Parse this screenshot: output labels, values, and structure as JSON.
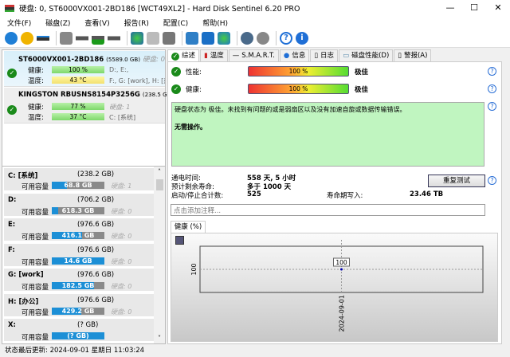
{
  "window": {
    "title": "硬盘:  0, ST6000VX001-2BD186 [WCT49XL2]  -  Hard Disk Sentinel 6.20 PRO",
    "minimize": "—",
    "maximize": "☐",
    "close": "✕"
  },
  "menu": [
    "文件(F)",
    "磁盘(Z)",
    "查看(V)",
    "报告(R)",
    "配置(C)",
    "帮助(H)"
  ],
  "toolbar": [
    "refresh-icon",
    "refresh-warning-icon",
    "disk-icon",
    "disk-gray-icon",
    "disk-clock-icon",
    "disk-check-icon",
    "disk-search-icon",
    "network-disk-icon",
    "usb-icon",
    "external-disk-icon",
    "notepad-icon",
    "mail-icon",
    "globe-monitor-icon",
    "gear-icon",
    "sound-icon",
    "help-icon",
    "info-icon"
  ],
  "disks": [
    {
      "name": "ST6000VX001-2BD186",
      "size": "(5589.0 GB)",
      "disk_no": "硬盘:  0",
      "health_label": "健康:",
      "health": "100 %",
      "health_pct": 100,
      "temp_label": "温度:",
      "temp": "43 °C",
      "parts1": "D:, E:,",
      "parts2": "F:, G: [work], H: [办公]"
    },
    {
      "name": "KINGSTON RBUSNS8154P3256G",
      "size": "(238.5 GB)",
      "disk_no": "硬盘:  1",
      "health_label": "健康:",
      "health": "77 %",
      "health_pct": 77,
      "temp_label": "温度:",
      "temp": "37 °C",
      "parts1": "",
      "parts2": "C: [系统]"
    }
  ],
  "volumes": [
    {
      "name": "C: [系统]",
      "size": "(238.2 GB)",
      "label": "可用容量",
      "free": "68.8 GB",
      "free_pct": 29,
      "disk": "硬盘:  1"
    },
    {
      "name": "D:",
      "size": "(706.2 GB)",
      "label": "可用容量",
      "free": "618.3 GB",
      "free_pct": 12,
      "disk": "硬盘:  0"
    },
    {
      "name": "E:",
      "size": "(976.6 GB)",
      "label": "可用容量",
      "free": "416.1 GB",
      "free_pct": 57,
      "disk": "硬盘:  0"
    },
    {
      "name": "F:",
      "size": "(976.6 GB)",
      "label": "可用容量",
      "free": "14.6 GB",
      "free_pct": 100,
      "disk": "硬盘:  0"
    },
    {
      "name": "G: [work]",
      "size": "(976.6 GB)",
      "label": "可用容量",
      "free": "182.5 GB",
      "free_pct": 81,
      "disk": "硬盘:  0"
    },
    {
      "name": "H: [办公]",
      "size": "(976.6 GB)",
      "label": "可用容量",
      "free": "429.2 GB",
      "free_pct": 56,
      "disk": "硬盘:  0"
    },
    {
      "name": "X:",
      "size": "(? GB)",
      "label": "可用容量",
      "free": "(? GB)",
      "free_pct": 100,
      "disk": ""
    }
  ],
  "status": "状态最后更新:   2024-09-01 星期日 11:03:24",
  "tabs": [
    "综述",
    "温度",
    "S.M.A.R.T.",
    "信息",
    "日志",
    "磁盘性能(D)",
    "警报(A)"
  ],
  "summary": {
    "perf_label": "性能:",
    "perf": "100 %",
    "perf_rating": "极佳",
    "health_label": "健康:",
    "health": "100 %",
    "health_rating": "极佳",
    "message": "硬盘状态为 极佳。未找到有问题的或是弱扇区以及没有加速自旋或数据传输错误。",
    "action": "无需操作。",
    "power_on_label": "通电时间:",
    "power_on": "558 天, 5 小时",
    "remaining_label": "预计剩余寿命:",
    "remaining": "多于 1000 天",
    "starts_label": "启动/停止合计数:",
    "starts": "525",
    "written_label": "寿命期写入:",
    "written": "23.46 TB",
    "retest": "重复测试",
    "comment_placeholder": "点击添加注释...",
    "chart_tab": "健康 (%)"
  },
  "chart_data": {
    "type": "line",
    "x": [
      "2024-09-01"
    ],
    "values": [
      100
    ],
    "ytick": "100",
    "point_label": "100",
    "grid": true
  }
}
